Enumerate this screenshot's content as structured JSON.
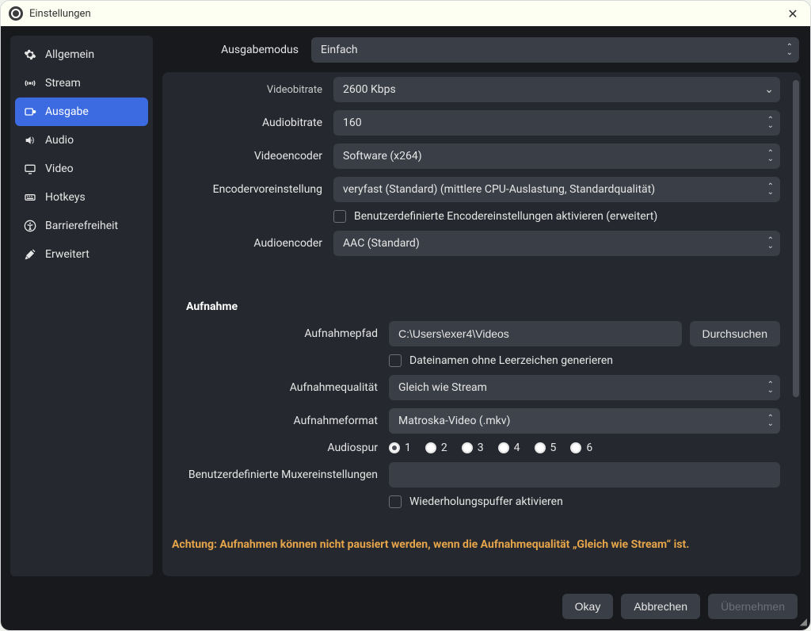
{
  "window": {
    "title": "Einstellungen"
  },
  "sidebar": {
    "items": [
      {
        "label": "Allgemein"
      },
      {
        "label": "Stream"
      },
      {
        "label": "Ausgabe"
      },
      {
        "label": "Audio"
      },
      {
        "label": "Video"
      },
      {
        "label": "Hotkeys"
      },
      {
        "label": "Barrierefreiheit"
      },
      {
        "label": "Erweitert"
      }
    ],
    "active_index": 2
  },
  "output_mode": {
    "label": "Ausgabemodus",
    "value": "Einfach"
  },
  "streaming": {
    "video_bitrate": {
      "label": "Videobitrate",
      "value": "2600 Kbps"
    },
    "audio_bitrate": {
      "label": "Audiobitrate",
      "value": "160"
    },
    "video_encoder": {
      "label": "Videoencoder",
      "value": "Software (x264)"
    },
    "encoder_preset": {
      "label": "Encodervoreinstellung",
      "value": "veryfast (Standard) (mittlere CPU-Auslastung, Standardqualität)"
    },
    "custom_encoder_checkbox": "Benutzerdefinierte Encodereinstellungen aktivieren (erweitert)",
    "audio_encoder": {
      "label": "Audioencoder",
      "value": "AAC (Standard)"
    }
  },
  "recording": {
    "section_title": "Aufnahme",
    "path": {
      "label": "Aufnahmepfad",
      "value": "C:\\Users\\exer4\\Videos",
      "browse": "Durchsuchen"
    },
    "no_spaces_checkbox": "Dateinamen ohne Leerzeichen generieren",
    "quality": {
      "label": "Aufnahmequalität",
      "value": "Gleich wie Stream"
    },
    "format": {
      "label": "Aufnahmeformat",
      "value": "Matroska-Video (.mkv)"
    },
    "audio_track": {
      "label": "Audiospur",
      "options": [
        "1",
        "2",
        "3",
        "4",
        "5",
        "6"
      ],
      "selected_index": 0
    },
    "muxer": {
      "label": "Benutzerdefinierte Muxereinstellungen",
      "value": ""
    },
    "replay_buffer_checkbox": "Wiederholungspuffer aktivieren"
  },
  "warning": "Achtung: Aufnahmen können nicht pausiert werden, wenn die Aufnahmequalität „Gleich wie Stream“ ist.",
  "footer": {
    "ok": "Okay",
    "cancel": "Abbrechen",
    "apply": "Übernehmen"
  }
}
